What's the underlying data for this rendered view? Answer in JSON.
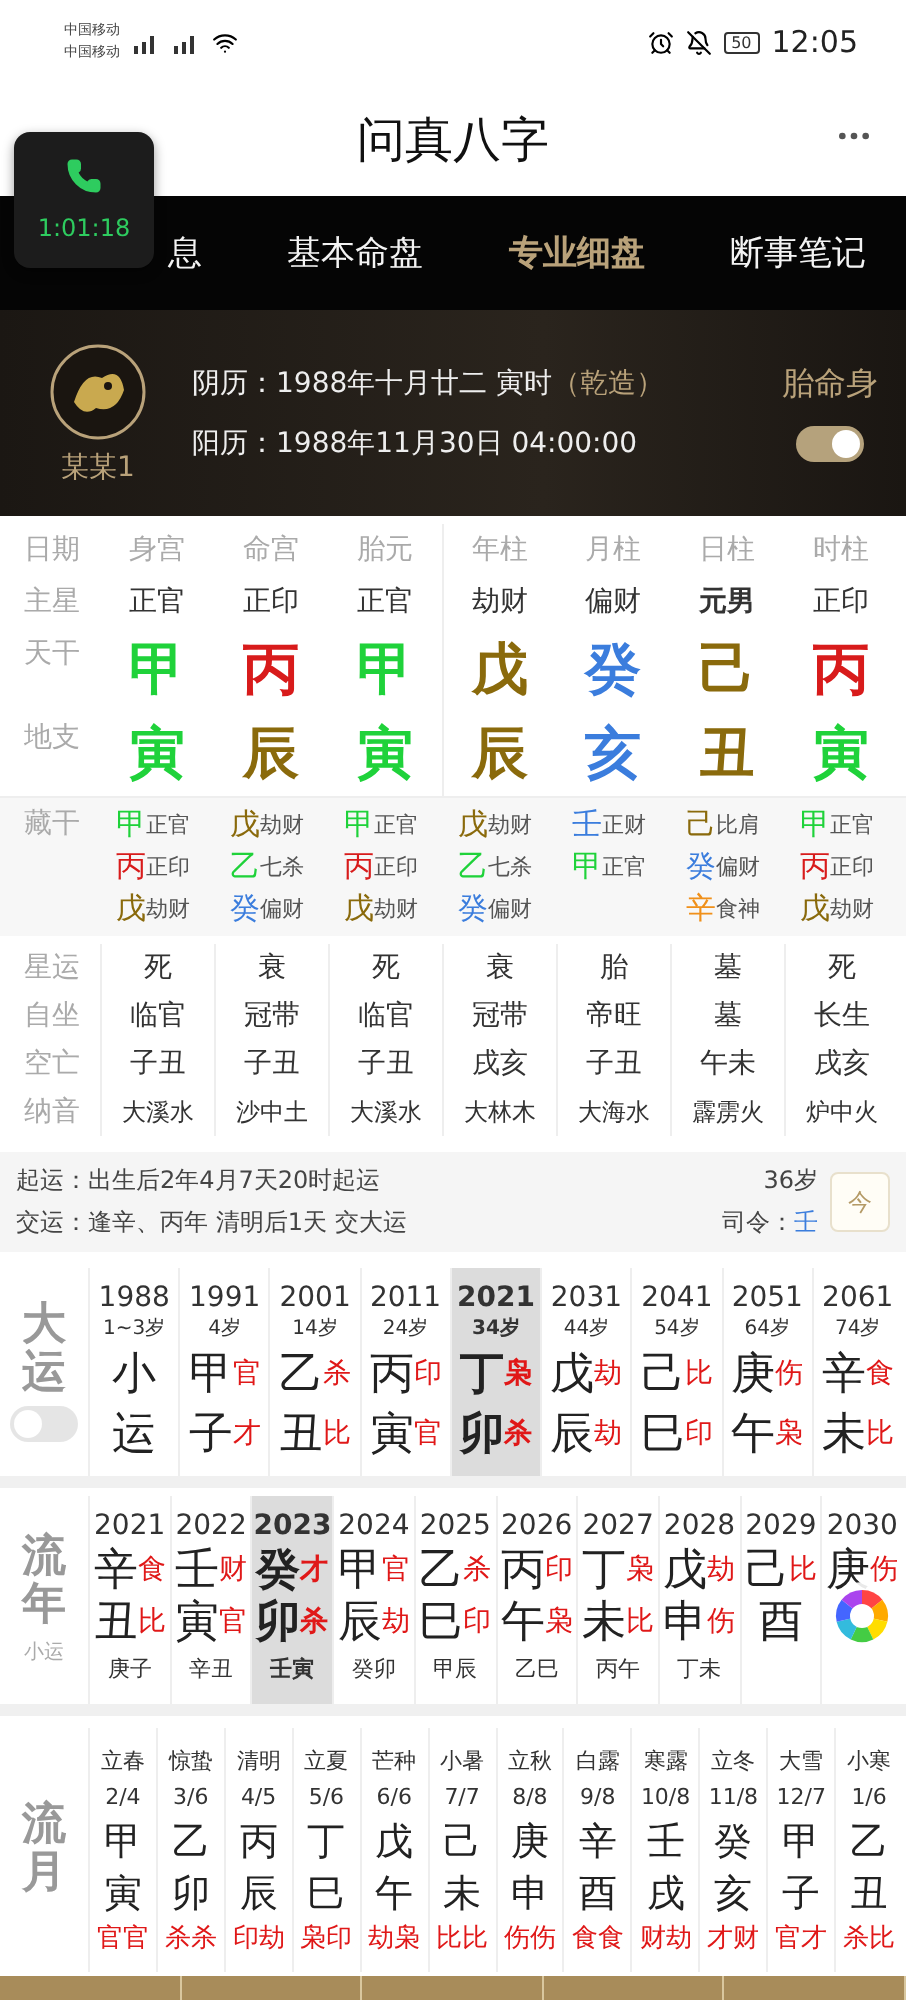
{
  "status_bar": {
    "carriers": [
      "中国移动",
      "中国移动"
    ],
    "battery": "50",
    "time": "12:05"
  },
  "header": {
    "title": "问真八字"
  },
  "call_overlay": {
    "duration": "1:01:18"
  },
  "tabs": [
    {
      "label": "息",
      "selected": false
    },
    {
      "label": "基本命盘",
      "selected": false
    },
    {
      "label": "专业细盘",
      "selected": true
    },
    {
      "label": "断事笔记",
      "selected": false
    }
  ],
  "profile": {
    "name": "某某1",
    "lunar": "阴历：1988年十月廿二 寅时",
    "gender": "（乾造）",
    "solar": "阳历：1988年11月30日 04:00:00",
    "toggle_label": "胎命身",
    "toggle_on": true
  },
  "row_labels": [
    "日期",
    "主星",
    "天干",
    "地支",
    "藏干",
    "星运",
    "自坐",
    "空亡",
    "纳音"
  ],
  "pillars": [
    {
      "header": "身宫",
      "main_star": "正官",
      "stem": {
        "char": "甲",
        "color": "#1fd23a"
      },
      "branch": {
        "char": "寅",
        "color": "#1fd23a"
      },
      "hidden": [
        {
          "char": "甲",
          "color": "#1fd23a",
          "god": "正官"
        },
        {
          "char": "丙",
          "color": "#d81b1b",
          "god": "正印"
        },
        {
          "char": "戊",
          "color": "#8a6a0c",
          "god": "劫财"
        }
      ],
      "star_luck": "死",
      "self_seat": "临官",
      "void": "子丑",
      "nayin": "大溪水"
    },
    {
      "header": "命宫",
      "main_star": "正印",
      "stem": {
        "char": "丙",
        "color": "#d81b1b"
      },
      "branch": {
        "char": "辰",
        "color": "#8a6a0c"
      },
      "hidden": [
        {
          "char": "戊",
          "color": "#8a6a0c",
          "god": "劫财"
        },
        {
          "char": "乙",
          "color": "#1fd23a",
          "god": "七杀"
        },
        {
          "char": "癸",
          "color": "#3b7ddd",
          "god": "偏财"
        }
      ],
      "star_luck": "衰",
      "self_seat": "冠带",
      "void": "子丑",
      "nayin": "沙中土"
    },
    {
      "header": "胎元",
      "main_star": "正官",
      "stem": {
        "char": "甲",
        "color": "#1fd23a"
      },
      "branch": {
        "char": "寅",
        "color": "#1fd23a"
      },
      "hidden": [
        {
          "char": "甲",
          "color": "#1fd23a",
          "god": "正官"
        },
        {
          "char": "丙",
          "color": "#d81b1b",
          "god": "正印"
        },
        {
          "char": "戊",
          "color": "#8a6a0c",
          "god": "劫财"
        }
      ],
      "star_luck": "死",
      "self_seat": "临官",
      "void": "子丑",
      "nayin": "大溪水"
    },
    {
      "header": "年柱",
      "main_star": "劫财",
      "stem": {
        "char": "戊",
        "color": "#8a6a0c"
      },
      "branch": {
        "char": "辰",
        "color": "#8a6a0c"
      },
      "hidden": [
        {
          "char": "戊",
          "color": "#8a6a0c",
          "god": "劫财"
        },
        {
          "char": "乙",
          "color": "#1fd23a",
          "god": "七杀"
        },
        {
          "char": "癸",
          "color": "#3b7ddd",
          "god": "偏财"
        }
      ],
      "star_luck": "衰",
      "self_seat": "冠带",
      "void": "戌亥",
      "nayin": "大林木"
    },
    {
      "header": "月柱",
      "main_star": "偏财",
      "stem": {
        "char": "癸",
        "color": "#3b7ddd"
      },
      "branch": {
        "char": "亥",
        "color": "#3b7ddd"
      },
      "hidden": [
        {
          "char": "壬",
          "color": "#3b7ddd",
          "god": "正财"
        },
        {
          "char": "甲",
          "color": "#1fd23a",
          "god": "正官"
        }
      ],
      "star_luck": "胎",
      "self_seat": "帝旺",
      "void": "子丑",
      "nayin": "大海水"
    },
    {
      "header": "日柱",
      "main_star": "元男",
      "stem": {
        "char": "己",
        "color": "#8a6a0c"
      },
      "branch": {
        "char": "丑",
        "color": "#8a6a0c"
      },
      "hidden": [
        {
          "char": "己",
          "color": "#8a6a0c",
          "god": "比肩"
        },
        {
          "char": "癸",
          "color": "#3b7ddd",
          "god": "偏财"
        },
        {
          "char": "辛",
          "color": "#f0901a",
          "god": "食神"
        }
      ],
      "star_luck": "墓",
      "self_seat": "墓",
      "void": "午未",
      "nayin": "霹雳火"
    },
    {
      "header": "时柱",
      "main_star": "正印",
      "stem": {
        "char": "丙",
        "color": "#d81b1b"
      },
      "branch": {
        "char": "寅",
        "color": "#1fd23a"
      },
      "hidden": [
        {
          "char": "甲",
          "color": "#1fd23a",
          "god": "正官"
        },
        {
          "char": "丙",
          "color": "#d81b1b",
          "god": "正印"
        },
        {
          "char": "戊",
          "color": "#8a6a0c",
          "god": "劫财"
        }
      ],
      "star_luck": "死",
      "self_seat": "长生",
      "void": "戌亥",
      "nayin": "炉中火"
    }
  ],
  "qiyun": {
    "start_label": "起运：",
    "start": "出生后2年4月7天20时起运",
    "change_label": "交运：",
    "change": "逢辛、丙年 清明后1天 交大运",
    "age": "36岁",
    "commander_label": "司令：",
    "commander": "壬",
    "today_button": "今"
  },
  "dayun": {
    "label": "大运",
    "toggle_on": false,
    "columns": [
      {
        "year": "1988",
        "age": "1~3岁",
        "stem": "小",
        "branch": "运",
        "selected": false
      },
      {
        "year": "1991",
        "age": "4岁",
        "stem": "甲",
        "stem_god": "官",
        "branch": "子",
        "branch_god": "才",
        "selected": false
      },
      {
        "year": "2001",
        "age": "14岁",
        "stem": "乙",
        "stem_god": "杀",
        "branch": "丑",
        "branch_god": "比",
        "selected": false
      },
      {
        "year": "2011",
        "age": "24岁",
        "stem": "丙",
        "stem_god": "印",
        "branch": "寅",
        "branch_god": "官",
        "selected": false
      },
      {
        "year": "2021",
        "age": "34岁",
        "stem": "丁",
        "stem_god": "枭",
        "branch": "卯",
        "branch_god": "杀",
        "selected": true
      },
      {
        "year": "2031",
        "age": "44岁",
        "stem": "戊",
        "stem_god": "劫",
        "branch": "辰",
        "branch_god": "劫",
        "selected": false
      },
      {
        "year": "2041",
        "age": "54岁",
        "stem": "己",
        "stem_god": "比",
        "branch": "巳",
        "branch_god": "印",
        "selected": false
      },
      {
        "year": "2051",
        "age": "64岁",
        "stem": "庚",
        "stem_god": "伤",
        "branch": "午",
        "branch_god": "枭",
        "selected": false
      },
      {
        "year": "2061",
        "age": "74岁",
        "stem": "辛",
        "stem_god": "食",
        "branch": "未",
        "branch_god": "比",
        "selected": false
      }
    ]
  },
  "liunian": {
    "label": "流年",
    "sublabel": "小运",
    "columns": [
      {
        "year": "2021",
        "stem": "辛",
        "stem_god": "食",
        "branch": "丑",
        "branch_god": "比",
        "xiaoyun": "庚子",
        "selected": false
      },
      {
        "year": "2022",
        "stem": "壬",
        "stem_god": "财",
        "branch": "寅",
        "branch_god": "官",
        "xiaoyun": "辛丑",
        "selected": false
      },
      {
        "year": "2023",
        "stem": "癸",
        "stem_god": "才",
        "branch": "卯",
        "branch_god": "杀",
        "xiaoyun": "壬寅",
        "selected": true
      },
      {
        "year": "2024",
        "stem": "甲",
        "stem_god": "官",
        "branch": "辰",
        "branch_god": "劫",
        "xiaoyun": "癸卯",
        "selected": false
      },
      {
        "year": "2025",
        "stem": "乙",
        "stem_god": "杀",
        "branch": "巳",
        "branch_god": "印",
        "xiaoyun": "甲辰",
        "selected": false
      },
      {
        "year": "2026",
        "stem": "丙",
        "stem_god": "印",
        "branch": "午",
        "branch_god": "枭",
        "xiaoyun": "乙巳",
        "selected": false
      },
      {
        "year": "2027",
        "stem": "丁",
        "stem_god": "枭",
        "branch": "未",
        "branch_god": "比",
        "xiaoyun": "丙午",
        "selected": false
      },
      {
        "year": "2028",
        "stem": "戊",
        "stem_god": "劫",
        "branch": "申",
        "branch_god": "伤",
        "xiaoyun": "丁未",
        "selected": false
      },
      {
        "year": "2029",
        "stem": "己",
        "stem_god": "比",
        "branch": "酉",
        "selected": false
      },
      {
        "year": "2030",
        "stem": "庚",
        "stem_god": "伤",
        "selected": false
      }
    ]
  },
  "liuyue": {
    "label": "流月",
    "columns": [
      {
        "term": "立春",
        "date": "2/4",
        "stem": "甲",
        "branch": "寅",
        "gods": "官官"
      },
      {
        "term": "惊蛰",
        "date": "3/6",
        "stem": "乙",
        "branch": "卯",
        "gods": "杀杀"
      },
      {
        "term": "清明",
        "date": "4/5",
        "stem": "丙",
        "branch": "辰",
        "gods": "印劫"
      },
      {
        "term": "立夏",
        "date": "5/6",
        "stem": "丁",
        "branch": "巳",
        "gods": "枭印"
      },
      {
        "term": "芒种",
        "date": "6/6",
        "stem": "戊",
        "branch": "午",
        "gods": "劫枭"
      },
      {
        "term": "小暑",
        "date": "7/7",
        "stem": "己",
        "branch": "未",
        "gods": "比比"
      },
      {
        "term": "立秋",
        "date": "8/8",
        "stem": "庚",
        "branch": "申",
        "gods": "伤伤"
      },
      {
        "term": "白露",
        "date": "9/8",
        "stem": "辛",
        "branch": "酉",
        "gods": "食食"
      },
      {
        "term": "寒露",
        "date": "10/8",
        "stem": "壬",
        "branch": "戌",
        "gods": "财劫"
      },
      {
        "term": "立冬",
        "date": "11/8",
        "stem": "癸",
        "branch": "亥",
        "gods": "才财"
      },
      {
        "term": "大雪",
        "date": "12/7",
        "stem": "甲",
        "branch": "子",
        "gods": "官才"
      },
      {
        "term": "小寒",
        "date": "1/6",
        "stem": "乙",
        "branch": "丑",
        "gods": "杀比"
      }
    ]
  }
}
